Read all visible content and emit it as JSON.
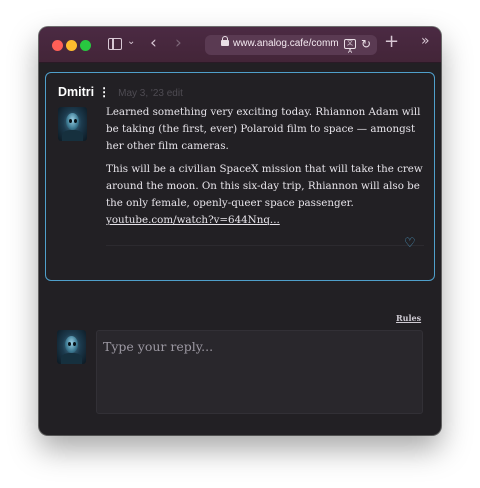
{
  "browser": {
    "url": "www.analog.cafe/comm",
    "translate_label": "文A"
  },
  "comment": {
    "author": "Dmitri",
    "meta": "May 3, '23 edit",
    "paragraphs": [
      "Learned something very exciting today. Rhiannon Adam will be taking (the first, ever) Polaroid film to space — amongst her other film cameras.",
      "This will be a civilian SpaceX mission that will take the crew around the moon. On this six-day trip, Rhiannon will also be the only female, openly-queer space passenger."
    ],
    "link": "youtube.com/watch?v=644Nnq..."
  },
  "reply": {
    "rules_label": "Rules",
    "placeholder": "Type your reply..."
  },
  "colors": {
    "accent": "#4f9fca",
    "background": "#222024",
    "toolbar": "#4b2a43"
  },
  "icons": [
    "sidebar-icon",
    "chevron-down-icon",
    "back-icon",
    "forward-icon",
    "lock-icon",
    "translate-icon",
    "reload-icon",
    "plus-icon",
    "more-icon",
    "kebab-icon",
    "heart-icon",
    "avatar"
  ]
}
